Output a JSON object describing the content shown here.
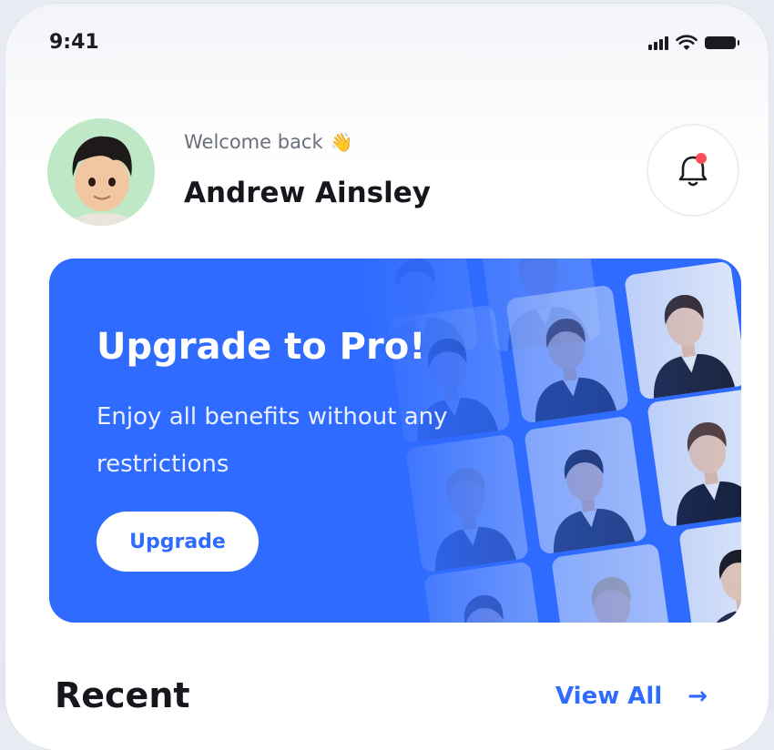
{
  "status_bar": {
    "time": "9:41"
  },
  "header": {
    "greeting": "Welcome back",
    "greeting_emoji": "👋",
    "user_name": "Andrew Ainsley"
  },
  "banner": {
    "title": "Upgrade to Pro!",
    "subtitle": "Enjoy all benefits without any restrictions",
    "button_label": "Upgrade"
  },
  "recent": {
    "title": "Recent",
    "view_all_label": "View All",
    "arrow": "→"
  },
  "colors": {
    "accent": "#2f6bff",
    "avatar_bg": "#bfe8c6",
    "notification_dot": "#ff4d5a"
  },
  "icons": [
    "signal-icon",
    "wifi-icon",
    "battery-icon",
    "bell-icon",
    "wave-hand-icon",
    "arrow-right-icon"
  ]
}
